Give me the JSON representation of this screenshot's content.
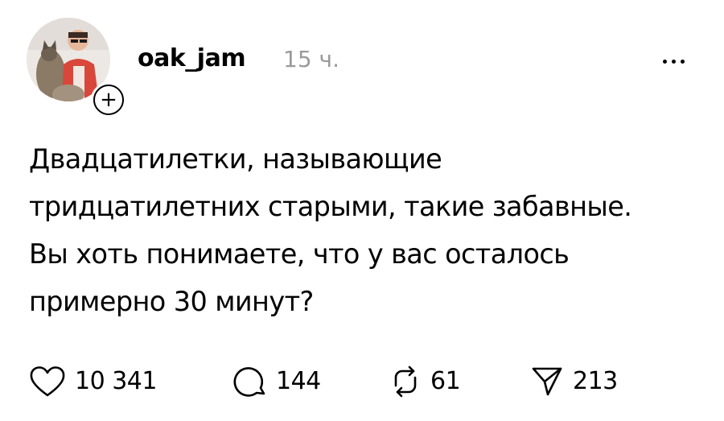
{
  "post": {
    "author": {
      "username": "oak_jam",
      "follow_symbol": "+"
    },
    "time": "15 ч.",
    "text": "Двадцатилетки, называющие\nтридцатилетних старыми, такие забавные.\nВы хоть понимаете, что у вас осталось\nпримерно 30 минут?",
    "actions": {
      "likes": "10 341",
      "replies": "144",
      "reposts": "61",
      "shares": "213"
    }
  },
  "icons": {
    "more": "more-horizontal-icon",
    "like": "heart-icon",
    "reply": "comment-bubble-icon",
    "repost": "repost-icon",
    "share": "send-icon"
  }
}
